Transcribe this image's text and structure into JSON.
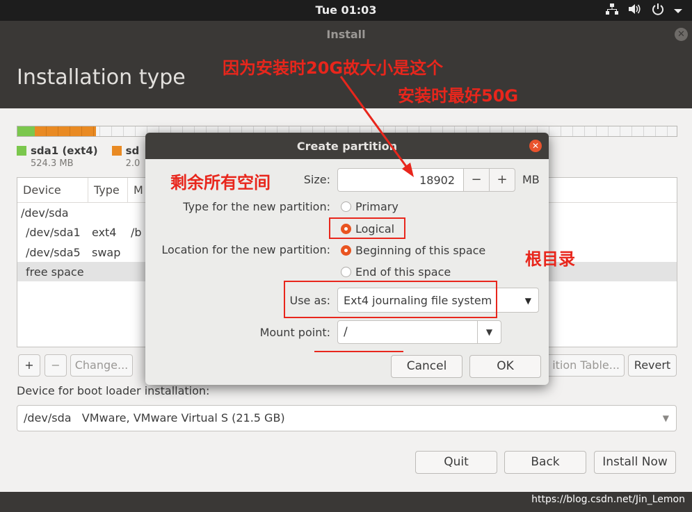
{
  "topbar": {
    "clock": "Tue 01:03",
    "icons": [
      "network-icon",
      "volume-icon",
      "power-icon",
      "menu-chevron-icon"
    ]
  },
  "window": {
    "title": "Install",
    "page_title": "Installation type"
  },
  "partition_bar": {
    "colors": {
      "sda1": "#7bc74d",
      "sda5": "#e98a23"
    }
  },
  "legend": [
    {
      "name": "sda1 (ext4)",
      "size": "524.3 MB",
      "color": "#7bc74d"
    },
    {
      "name": "sd",
      "size": "2.0",
      "color": "#e98a23"
    }
  ],
  "table": {
    "headers": [
      "Device",
      "Type",
      "M"
    ],
    "rows": [
      {
        "device": "/dev/sda",
        "type": "",
        "mount": ""
      },
      {
        "device": "/dev/sda1",
        "type": "ext4",
        "mount": "/b"
      },
      {
        "device": "/dev/sda5",
        "type": "swap",
        "mount": ""
      },
      {
        "device": "free space",
        "type": "",
        "mount": ""
      }
    ]
  },
  "table_toolbar": {
    "add": "+",
    "remove": "−",
    "change": "Change...",
    "new_table": "ition Table...",
    "revert": "Revert"
  },
  "boot_loader": {
    "label": "Device for boot loader installation:",
    "value": "/dev/sda   VMware, VMware Virtual S (21.5 GB)"
  },
  "buttons": {
    "quit": "Quit",
    "back": "Back",
    "install": "Install Now"
  },
  "watermark": "https://blog.csdn.net/Jin_Lemon",
  "dialog": {
    "title": "Create partition",
    "size_label": "Size:",
    "size_value": "18902",
    "size_unit": "MB",
    "minus": "−",
    "plus": "+",
    "type_label": "Type for the new partition:",
    "type_primary": "Primary",
    "type_logical": "Logical",
    "type_selected": "Logical",
    "location_label": "Location for the new partition:",
    "location_begin": "Beginning of this space",
    "location_end": "End of this space",
    "location_selected": "Beginning of this space",
    "use_as_label": "Use as:",
    "use_as_value": "Ext4 journaling file system",
    "mount_label": "Mount point:",
    "mount_value": "/",
    "cancel": "Cancel",
    "ok": "OK"
  },
  "annotations": {
    "size_note": "因为安装时20G故大小是这个",
    "size_note2": "安装时最好50G",
    "remaining": "剩余所有空间",
    "root": "根目录",
    "color": "#e8261c"
  },
  "accent": "#e95420"
}
